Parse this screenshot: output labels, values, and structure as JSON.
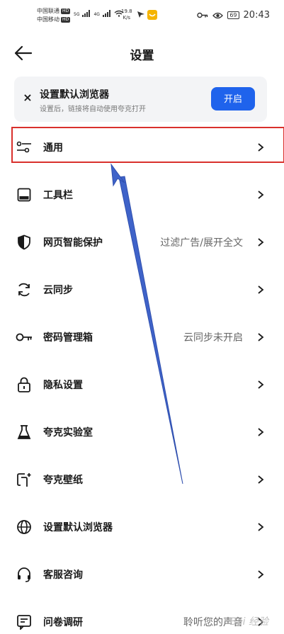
{
  "status_bar": {
    "carrier_1": "中国联通",
    "carrier_2": "中国移动",
    "hd": "HD",
    "net_5g": "5G",
    "net_4g": "4G",
    "speed_value": "19.8",
    "speed_unit": "K/s",
    "battery": "69",
    "time": "20:43"
  },
  "header": {
    "title": "设置"
  },
  "banner": {
    "title": "设置默认浏览器",
    "subtitle": "设置后，链接将自动使用夸克打开",
    "button_label": "开启"
  },
  "menu": {
    "items": [
      {
        "label": "通用",
        "value": "",
        "icon": "sliders-icon"
      },
      {
        "label": "工具栏",
        "value": "",
        "icon": "toolbar-icon"
      },
      {
        "label": "网页智能保护",
        "value": "过滤广告/展开全文",
        "icon": "shield-icon"
      },
      {
        "label": "云同步",
        "value": "",
        "icon": "sync-icon"
      },
      {
        "label": "密码管理箱",
        "value": "云同步未开启",
        "icon": "key-icon"
      },
      {
        "label": "隐私设置",
        "value": "",
        "icon": "lock-icon"
      },
      {
        "label": "夸克实验室",
        "value": "",
        "icon": "flask-icon"
      },
      {
        "label": "夸克壁纸",
        "value": "",
        "icon": "wallpaper-icon"
      },
      {
        "label": "设置默认浏览器",
        "value": "",
        "icon": "globe-icon"
      },
      {
        "label": "客服咨询",
        "value": "",
        "icon": "headset-icon"
      },
      {
        "label": "问卷调研",
        "value": "聆听您的声音",
        "icon": "survey-icon"
      }
    ]
  },
  "colors": {
    "accent": "#1f63ec",
    "highlight": "#d9302c",
    "annotation_arrow": "#3f63c9"
  },
  "watermark": "Bai 经验"
}
